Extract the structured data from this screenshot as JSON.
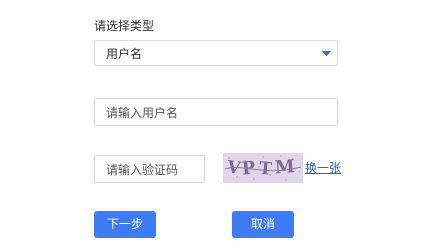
{
  "form": {
    "type_label": "请选择类型",
    "type_select": {
      "selected": "用户名"
    },
    "username_input": {
      "value": "",
      "placeholder": "请输入用户名"
    },
    "captcha_input": {
      "value": "",
      "placeholder": "请输入验证码"
    },
    "captcha_image_text": "VPTM",
    "refresh_link": "换一张",
    "next_button": "下一步",
    "cancel_button": "取消"
  },
  "colors": {
    "accent": "#3d7cf4",
    "link": "#2a5fd8",
    "border": "#dcdcdc",
    "captcha_bg": "#d8c8e6"
  },
  "icons": {
    "select_arrow": "chevron-down-icon"
  }
}
